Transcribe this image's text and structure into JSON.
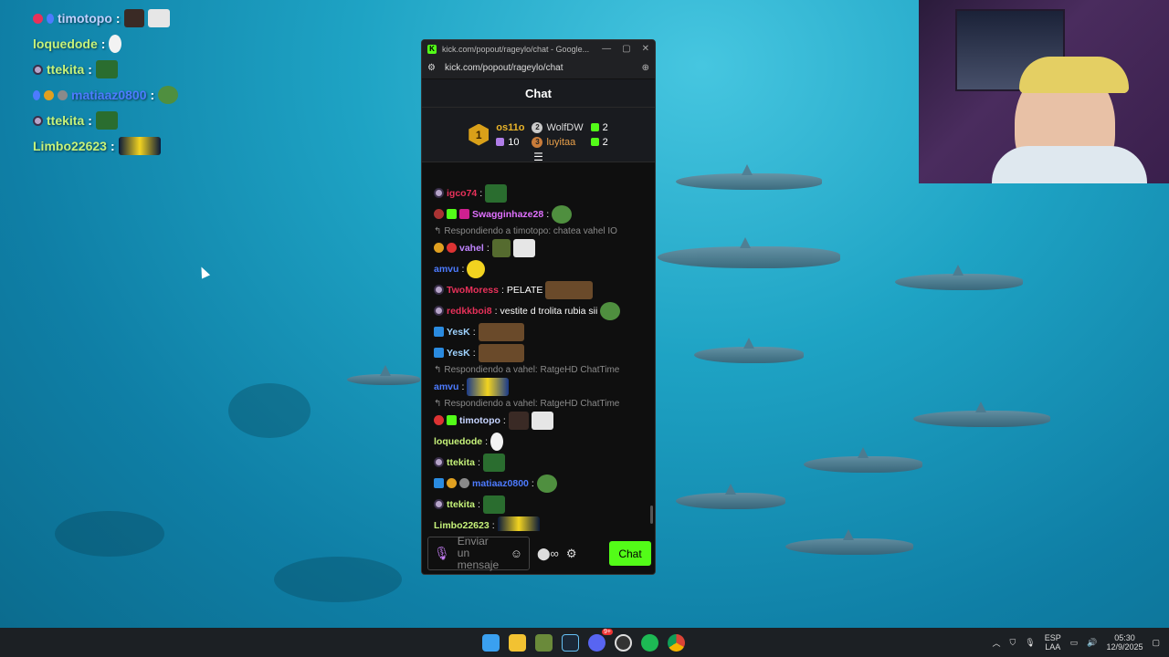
{
  "overlay": {
    "lines": [
      {
        "user": "timotopo",
        "color": "#9fb7ff"
      },
      {
        "user": "loquedode",
        "color": "#b7f06a"
      },
      {
        "user": "ttekita",
        "color": "#b7f06a"
      },
      {
        "user": "matiaaz0800",
        "color": "#4d7bff"
      },
      {
        "user": "ttekita",
        "color": "#b7f06a"
      },
      {
        "user": "Limbo22623",
        "color": "#b7f06a"
      }
    ]
  },
  "browser": {
    "title": "kick.com/popout/rageylo/chat - Google...",
    "url": "kick.com/popout/rageylo/chat",
    "logo": "K"
  },
  "chat": {
    "header": "Chat",
    "gifters": {
      "first": {
        "rank": "1",
        "name": "os11o",
        "count": "10"
      },
      "second": {
        "rank": "2",
        "name": "WolfDW",
        "count": "2"
      },
      "third": {
        "rank": "3",
        "name": "luyitaa",
        "count": "2"
      }
    },
    "messages": [
      {
        "user": "igco74",
        "color": "#e8315a",
        "text": ""
      },
      {
        "user": "Swagginhaze28",
        "color": "#e070ff",
        "text": ""
      },
      {
        "reply": "Respondiendo a timotopo: chatea vahel IO"
      },
      {
        "user": "vahel",
        "color": "#c084ff",
        "text": ""
      },
      {
        "user": "amvu",
        "color": "#4d7bff",
        "text": ""
      },
      {
        "user": "TwoMoress",
        "color": "#e8315a",
        "text": " PELATE"
      },
      {
        "user": "redkkboi8",
        "color": "#e8315a",
        "text": " vestite d trolita rubia sii"
      },
      {
        "user": "YesK",
        "color": "#9fd3ff",
        "text": ""
      },
      {
        "user": "YesK",
        "color": "#9fd3ff",
        "text": ""
      },
      {
        "reply": "Respondiendo a vahel: RatgeHD ChatTime"
      },
      {
        "user": "amvu",
        "color": "#4d7bff",
        "text": ""
      },
      {
        "reply": "Respondiendo a vahel: RatgeHD ChatTime"
      },
      {
        "user": "timotopo",
        "color": "#c6d4ff",
        "text": ""
      },
      {
        "user": "loquedode",
        "color": "#c6f27a",
        "text": ""
      },
      {
        "user": "ttekita",
        "color": "#c6f27a",
        "text": ""
      },
      {
        "user": "matiaaz0800",
        "color": "#4d7bff",
        "text": ""
      },
      {
        "user": "ttekita",
        "color": "#c6f27a",
        "text": ""
      },
      {
        "user": "Limbo22623",
        "color": "#c6f27a",
        "text": ""
      }
    ],
    "composer": {
      "placeholder": "Enviar un mensaje",
      "send_label": "Chat"
    }
  },
  "taskbar": {
    "language_top": "ESP",
    "language_bottom": "LAA",
    "time": "05:30",
    "date": "12/9/2025",
    "discord_badge": "9+"
  },
  "colors": {
    "kick_green": "#53fc18",
    "chat_bg": "#0f0f0f",
    "taskbar_bg": "#1c2024"
  }
}
